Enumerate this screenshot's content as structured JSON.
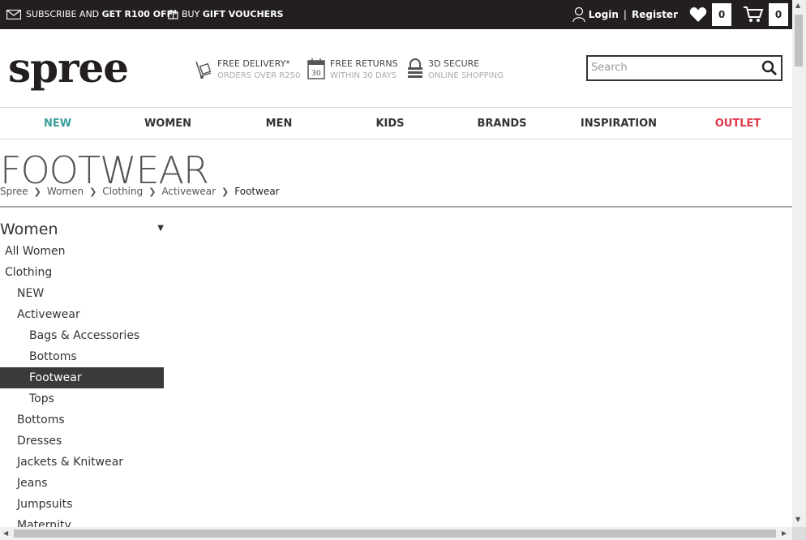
{
  "topbar": {
    "subscribe_prefix": "SUBSCRIBE AND ",
    "subscribe_bold": "GET R100 OFF*",
    "vouchers_prefix": "BUY ",
    "vouchers_bold": "GIFT VOUCHERS",
    "login": "Login",
    "separator": "|",
    "register": "Register",
    "wishlist_count": "0",
    "cart_count": "0"
  },
  "header": {
    "logo": "spree",
    "usps": [
      {
        "title": "FREE DELIVERY*",
        "sub": "ORDERS OVER R250",
        "icon": "delivery-trolley-icon"
      },
      {
        "title": "FREE RETURNS",
        "sub": "WITHIN 30 DAYS",
        "icon": "calendar-icon",
        "icon_text": "30"
      },
      {
        "title": "3D SECURE",
        "sub": "ONLINE SHOPPING",
        "icon": "lock-icon"
      }
    ],
    "search_placeholder": "Search"
  },
  "nav": {
    "items": [
      {
        "label": "NEW",
        "color": "#3a9e9a"
      },
      {
        "label": "WOMEN",
        "color": "#333333"
      },
      {
        "label": "MEN",
        "color": "#333333"
      },
      {
        "label": "KIDS",
        "color": "#333333"
      },
      {
        "label": "BRANDS",
        "color": "#333333"
      },
      {
        "label": "INSPIRATION",
        "color": "#333333"
      },
      {
        "label": "OUTLET",
        "color": "#e2374a"
      }
    ]
  },
  "page": {
    "title": "FOOTWEAR",
    "breadcrumb": [
      "Spree",
      "Women",
      "Clothing",
      "Activewear",
      "Footwear"
    ]
  },
  "sidebar": {
    "title": "Women",
    "items": [
      {
        "label": "All Women",
        "level": 1
      },
      {
        "label": "Clothing",
        "level": 1
      },
      {
        "label": "NEW",
        "level": 2
      },
      {
        "label": "Activewear",
        "level": 2
      },
      {
        "label": "Bags & Accessories",
        "level": 3
      },
      {
        "label": "Bottoms",
        "level": 3
      },
      {
        "label": "Footwear",
        "level": 3,
        "active": true
      },
      {
        "label": "Tops",
        "level": 3
      },
      {
        "label": "Bottoms",
        "level": 2
      },
      {
        "label": "Dresses",
        "level": 2
      },
      {
        "label": "Jackets & Knitwear",
        "level": 2
      },
      {
        "label": "Jeans",
        "level": 2
      },
      {
        "label": "Jumpsuits",
        "level": 2
      },
      {
        "label": "Maternity",
        "level": 2
      }
    ]
  },
  "colors": {
    "topbar_bg": "#231f20",
    "accent_new": "#3a9e9a",
    "accent_outlet": "#e2374a",
    "active_item_bg": "#3a3a3a"
  }
}
